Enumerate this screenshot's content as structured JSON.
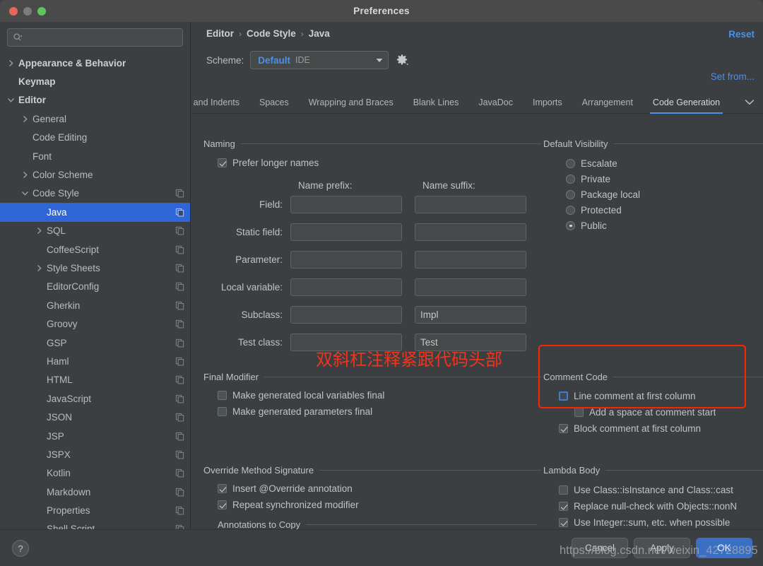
{
  "window": {
    "title": "Preferences",
    "traffic_lights": [
      "close-button",
      "minimize-button",
      "zoom-button"
    ]
  },
  "sidebar": {
    "search": {
      "value": "",
      "placeholder": "",
      "icon": "search-icon"
    },
    "items": [
      {
        "label": "Appearance & Behavior",
        "indent": 0,
        "arrow": "right",
        "bold": true,
        "copy": false,
        "selected": false
      },
      {
        "label": "Keymap",
        "indent": 0,
        "arrow": "none",
        "bold": true,
        "copy": false,
        "selected": false
      },
      {
        "label": "Editor",
        "indent": 0,
        "arrow": "down",
        "bold": true,
        "copy": false,
        "selected": false
      },
      {
        "label": "General",
        "indent": 1,
        "arrow": "right",
        "bold": false,
        "copy": false,
        "selected": false
      },
      {
        "label": "Code Editing",
        "indent": 1,
        "arrow": "none",
        "bold": false,
        "copy": false,
        "selected": false
      },
      {
        "label": "Font",
        "indent": 1,
        "arrow": "none",
        "bold": false,
        "copy": false,
        "selected": false
      },
      {
        "label": "Color Scheme",
        "indent": 1,
        "arrow": "right",
        "bold": false,
        "copy": false,
        "selected": false
      },
      {
        "label": "Code Style",
        "indent": 1,
        "arrow": "down",
        "bold": false,
        "copy": true,
        "selected": false
      },
      {
        "label": "Java",
        "indent": 2,
        "arrow": "none",
        "bold": false,
        "copy": true,
        "selected": true
      },
      {
        "label": "SQL",
        "indent": 2,
        "arrow": "right",
        "bold": false,
        "copy": true,
        "selected": false
      },
      {
        "label": "CoffeeScript",
        "indent": 2,
        "arrow": "none",
        "bold": false,
        "copy": true,
        "selected": false
      },
      {
        "label": "Style Sheets",
        "indent": 2,
        "arrow": "right",
        "bold": false,
        "copy": true,
        "selected": false
      },
      {
        "label": "EditorConfig",
        "indent": 2,
        "arrow": "none",
        "bold": false,
        "copy": true,
        "selected": false
      },
      {
        "label": "Gherkin",
        "indent": 2,
        "arrow": "none",
        "bold": false,
        "copy": true,
        "selected": false
      },
      {
        "label": "Groovy",
        "indent": 2,
        "arrow": "none",
        "bold": false,
        "copy": true,
        "selected": false
      },
      {
        "label": "GSP",
        "indent": 2,
        "arrow": "none",
        "bold": false,
        "copy": true,
        "selected": false
      },
      {
        "label": "Haml",
        "indent": 2,
        "arrow": "none",
        "bold": false,
        "copy": true,
        "selected": false
      },
      {
        "label": "HTML",
        "indent": 2,
        "arrow": "none",
        "bold": false,
        "copy": true,
        "selected": false
      },
      {
        "label": "JavaScript",
        "indent": 2,
        "arrow": "none",
        "bold": false,
        "copy": true,
        "selected": false
      },
      {
        "label": "JSON",
        "indent": 2,
        "arrow": "none",
        "bold": false,
        "copy": true,
        "selected": false
      },
      {
        "label": "JSP",
        "indent": 2,
        "arrow": "none",
        "bold": false,
        "copy": true,
        "selected": false
      },
      {
        "label": "JSPX",
        "indent": 2,
        "arrow": "none",
        "bold": false,
        "copy": true,
        "selected": false
      },
      {
        "label": "Kotlin",
        "indent": 2,
        "arrow": "none",
        "bold": false,
        "copy": true,
        "selected": false
      },
      {
        "label": "Markdown",
        "indent": 2,
        "arrow": "none",
        "bold": false,
        "copy": true,
        "selected": false
      },
      {
        "label": "Properties",
        "indent": 2,
        "arrow": "none",
        "bold": false,
        "copy": true,
        "selected": false
      },
      {
        "label": "Shell Script",
        "indent": 2,
        "arrow": "none",
        "bold": false,
        "copy": true,
        "selected": false
      }
    ]
  },
  "header": {
    "breadcrumb": [
      "Editor",
      "Code Style",
      "Java"
    ],
    "separator": "›",
    "reset_label": "Reset",
    "set_from_label": "Set from...",
    "scheme_label": "Scheme:",
    "scheme_value": "Default",
    "scheme_scope": "IDE",
    "gear_icon": "gear-icon"
  },
  "tabs": [
    {
      "label": "bs and Indents",
      "active": false,
      "clipped": true
    },
    {
      "label": "Spaces",
      "active": false,
      "clipped": false
    },
    {
      "label": "Wrapping and Braces",
      "active": false,
      "clipped": false
    },
    {
      "label": "Blank Lines",
      "active": false,
      "clipped": false
    },
    {
      "label": "JavaDoc",
      "active": false,
      "clipped": false
    },
    {
      "label": "Imports",
      "active": false,
      "clipped": false
    },
    {
      "label": "Arrangement",
      "active": false,
      "clipped": false
    },
    {
      "label": "Code Generation",
      "active": true,
      "clipped": false
    }
  ],
  "tabs_more_icon": "chevron-down-icon",
  "naming": {
    "title": "Naming",
    "prefer_longer_names": {
      "label": "Prefer longer names",
      "checked": true
    },
    "col_prefix": "Name prefix:",
    "col_suffix": "Name suffix:",
    "rows": [
      {
        "label": "Field:",
        "prefix": "",
        "suffix": ""
      },
      {
        "label": "Static field:",
        "prefix": "",
        "suffix": ""
      },
      {
        "label": "Parameter:",
        "prefix": "",
        "suffix": ""
      },
      {
        "label": "Local variable:",
        "prefix": "",
        "suffix": ""
      },
      {
        "label": "Subclass:",
        "prefix": "",
        "suffix": "Impl"
      },
      {
        "label": "Test class:",
        "prefix": "",
        "suffix": "Test"
      }
    ]
  },
  "default_visibility": {
    "title": "Default Visibility",
    "options": [
      {
        "label": "Escalate",
        "selected": false
      },
      {
        "label": "Private",
        "selected": false
      },
      {
        "label": "Package local",
        "selected": false
      },
      {
        "label": "Protected",
        "selected": false
      },
      {
        "label": "Public",
        "selected": true
      }
    ]
  },
  "final_modifier": {
    "title": "Final Modifier",
    "options": [
      {
        "label": "Make generated local variables final",
        "checked": false
      },
      {
        "label": "Make generated parameters final",
        "checked": false
      }
    ]
  },
  "comment_code": {
    "title": "Comment Code",
    "options": [
      {
        "label": "Line comment at first column",
        "checked": false,
        "focused": true,
        "indent": 0
      },
      {
        "label": "Add a space at comment start",
        "checked": false,
        "focused": false,
        "indent": 1
      },
      {
        "label": "Block comment at first column",
        "checked": true,
        "focused": false,
        "indent": 0
      }
    ]
  },
  "override_method_signature": {
    "title": "Override Method Signature",
    "options": [
      {
        "label": "Insert @Override annotation",
        "checked": true
      },
      {
        "label": "Repeat synchronized modifier",
        "checked": true
      }
    ],
    "annotations_to_copy": {
      "title": "Annotations to Copy",
      "value": ""
    }
  },
  "lambda_body": {
    "title": "Lambda Body",
    "options": [
      {
        "label": "Use Class::isInstance and Class::cast",
        "checked": false
      },
      {
        "label": "Replace null-check with Objects::nonN",
        "checked": true
      },
      {
        "label": "Use Integer::sum, etc. when possible",
        "checked": true
      }
    ]
  },
  "annotation": {
    "text": "双斜杠注释紧跟代码头部",
    "color": "#f0341c"
  },
  "footer": {
    "help_label": "?",
    "buttons": [
      {
        "label": "Cancel",
        "primary": false
      },
      {
        "label": "Apply",
        "primary": false
      },
      {
        "label": "OK",
        "primary": true
      }
    ]
  },
  "watermark": {
    "text": "https://blog.csdn.net/weixin_42728895"
  },
  "colors": {
    "accent_blue": "#4d90e8",
    "selection_blue": "#2f65d4",
    "button_blue": "#3b6fc4",
    "annotation_red": "#ff2400",
    "panel_bg": "#3c3f41",
    "titlebar_bg": "#4a4a4a",
    "field_bg": "#45494a"
  }
}
